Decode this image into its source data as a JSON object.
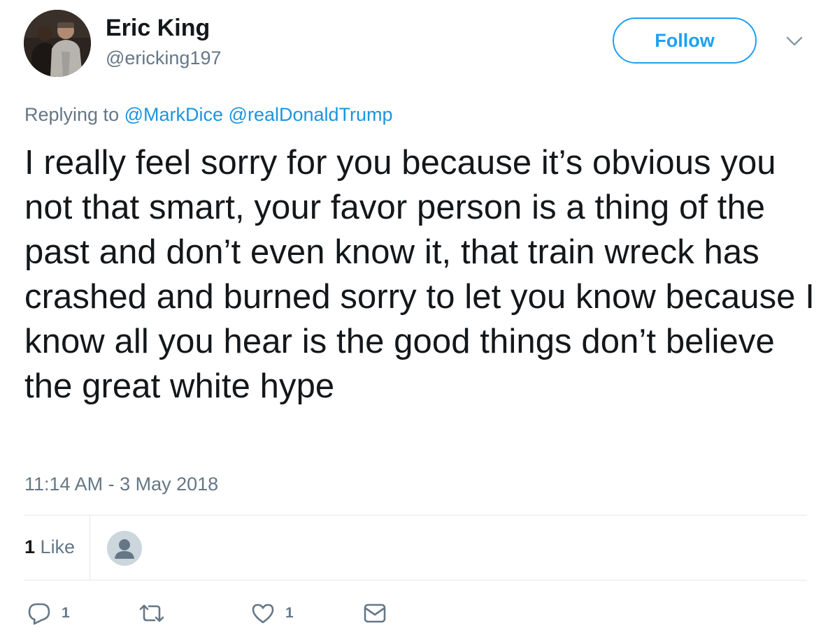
{
  "author": {
    "display_name": "Eric King",
    "handle": "@ericking197"
  },
  "header": {
    "follow_label": "Follow"
  },
  "reply_context": {
    "prefix": "Replying to",
    "mentions": [
      "@MarkDice",
      "@realDonaldTrump"
    ]
  },
  "tweet": {
    "text": "I really feel sorry for you because it’s obvious you not that smart, your favor person is a thing of the past and don’t even know it, that train wreck has crashed and burned sorry to let you know because I know all you hear is the good things don’t believe the great white hype",
    "timestamp": "11:14 AM - 3 May 2018"
  },
  "stats": {
    "likes_count": "1",
    "likes_label": "Like"
  },
  "actions": {
    "reply_count": "1",
    "like_count": "1"
  },
  "colors": {
    "accent": "#1da1f2",
    "link": "#1b95e0",
    "secondary_text": "#657786",
    "divider": "#e1e8ed"
  },
  "icons": {
    "reply": "reply-icon",
    "retweet": "retweet-icon",
    "like": "heart-icon",
    "dm": "envelope-icon",
    "more": "chevron-down-icon"
  }
}
